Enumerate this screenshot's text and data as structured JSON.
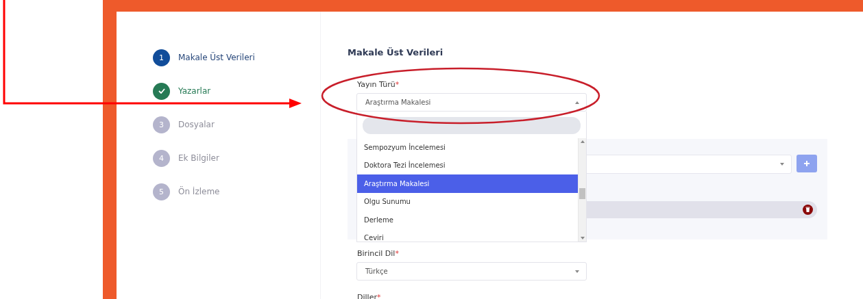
{
  "steps": [
    {
      "number": "1",
      "label": "Makale Üst Verileri",
      "selected": true,
      "completed": false
    },
    {
      "label": "Yazarlar",
      "selected": false,
      "completed": true
    },
    {
      "number": "3",
      "label": "Dosyalar",
      "selected": false,
      "completed": false
    },
    {
      "number": "4",
      "label": "Ek Bilgiler",
      "selected": false,
      "completed": false
    },
    {
      "number": "5",
      "label": "Ön İzleme",
      "selected": false,
      "completed": false
    }
  ],
  "form": {
    "title": "Makale Üst Verileri",
    "publication_type": {
      "label": "Yayın Türü",
      "required_mark": "*",
      "value": "Araştırma Makalesi",
      "expanded": true,
      "options": [
        {
          "label": "Sempozyum İncelemesi",
          "selected": false
        },
        {
          "label": "Doktora Tezi İncelemesi",
          "selected": false
        },
        {
          "label": "Araştırma Makalesi",
          "selected": true
        },
        {
          "label": "Olgu Sunumu",
          "selected": false
        },
        {
          "label": "Derleme",
          "selected": false
        },
        {
          "label": "Ceviri",
          "selected": false
        }
      ]
    },
    "primary_language": {
      "label": "Birincil Dil",
      "required_mark": "*",
      "value": "Türkçe"
    },
    "languages": {
      "label": "Diller",
      "required_mark": "*"
    }
  }
}
